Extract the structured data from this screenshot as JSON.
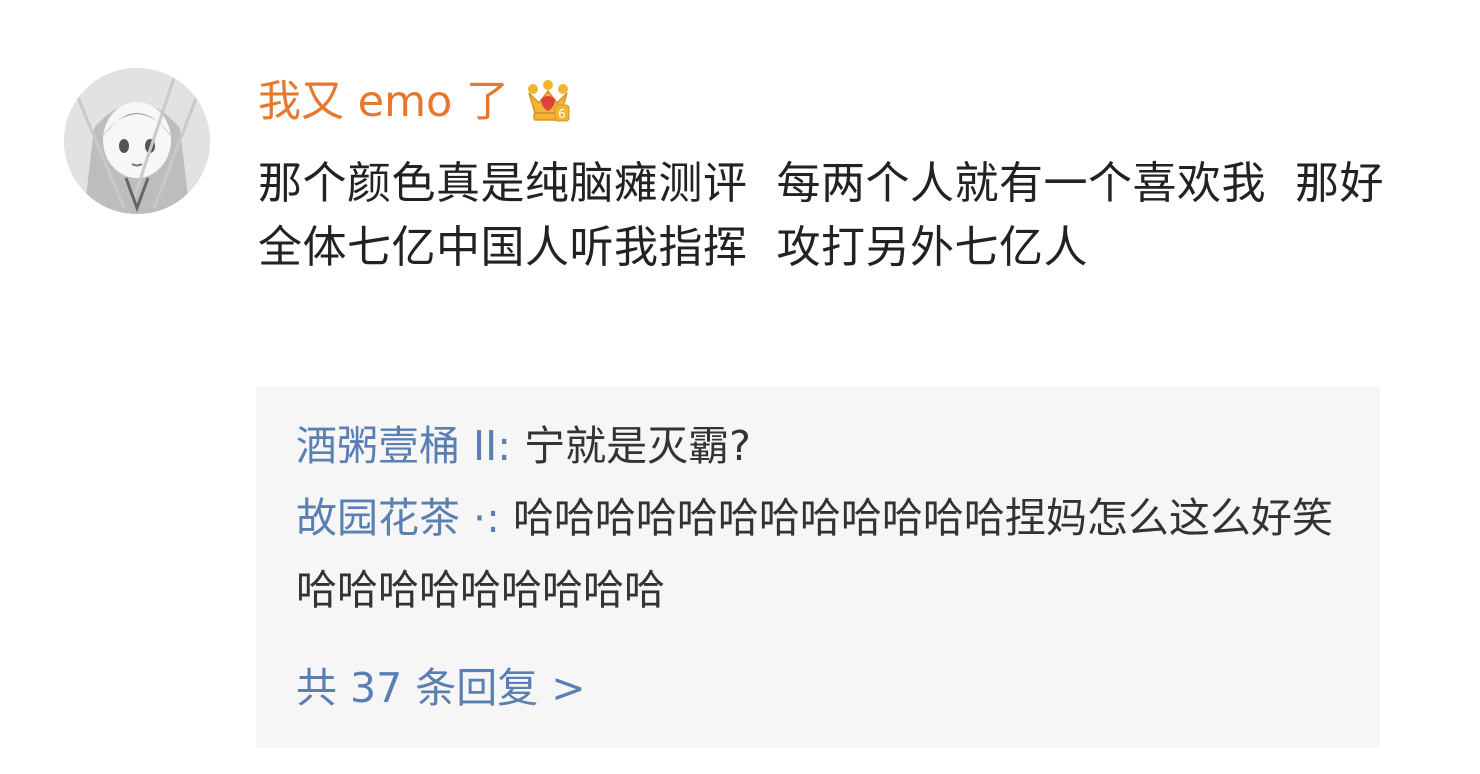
{
  "comment": {
    "avatar_alt": "avatar",
    "username": "我又 emo 了",
    "badge_icon": "crown-badge-icon",
    "badge_level": "6",
    "text": "那个颜色真是纯脑瘫测评  每两个人就有一个喜欢我  那好  全体七亿中国人听我指挥  攻打另外七亿人",
    "colors": {
      "username": "#e8772e",
      "reply_author": "#5a7fb2",
      "reply_box_bg": "#f6f6f6"
    }
  },
  "replies": [
    {
      "author": "酒粥壹桶 II",
      "separator": ": ",
      "text": "宁就是灭霸?"
    },
    {
      "author": "故园花茶 ·",
      "separator": ": ",
      "text": "哈哈哈哈哈哈哈哈哈哈哈哈捏妈怎么这么好笑哈哈哈哈哈哈哈哈哈"
    }
  ],
  "more_replies_label": "共 37 条回复 >"
}
